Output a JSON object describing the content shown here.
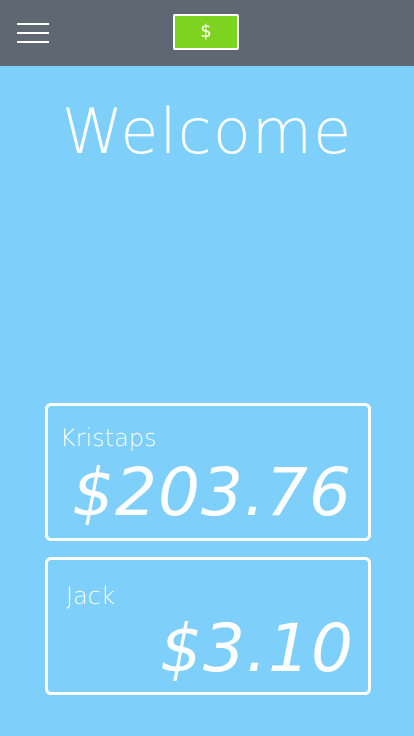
{
  "header": {
    "menu_icon": "hamburger-menu-icon",
    "currency_button_label": "$"
  },
  "main": {
    "title": "Welcome",
    "balances": [
      {
        "name": "Kristaps",
        "amount": "$203.76"
      },
      {
        "name": "Jack",
        "amount": "$3.10"
      }
    ]
  },
  "colors": {
    "background": "#7ed0fb",
    "topbar": "#5f6772",
    "accent_green": "#7ed321",
    "text": "#ffffff"
  }
}
